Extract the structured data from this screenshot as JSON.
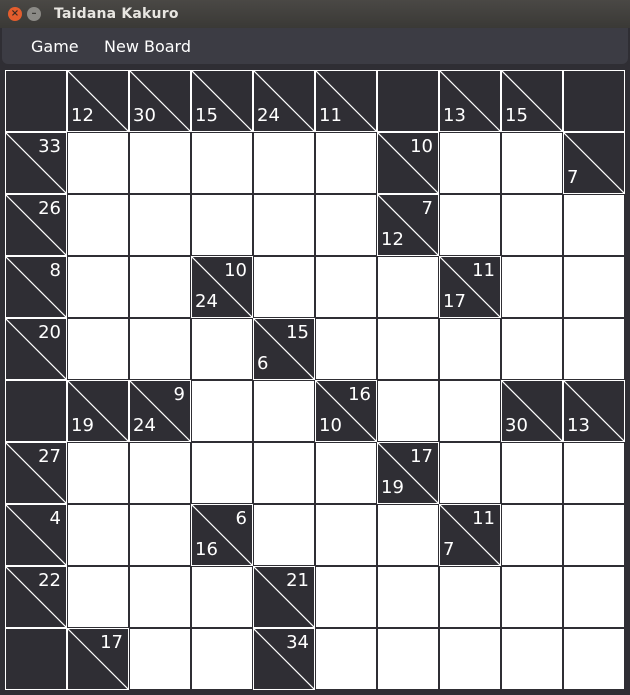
{
  "window": {
    "title": "Taidana Kakuro",
    "close_glyph": "×",
    "minimize_glyph": "–"
  },
  "menu": {
    "game": "Game",
    "new_board": "New Board"
  },
  "board": {
    "rows": [
      [
        {
          "t": "b"
        },
        {
          "t": "c",
          "d": "12"
        },
        {
          "t": "c",
          "d": "30"
        },
        {
          "t": "c",
          "d": "15"
        },
        {
          "t": "c",
          "d": "24"
        },
        {
          "t": "c",
          "d": "11"
        },
        {
          "t": "b"
        },
        {
          "t": "c",
          "d": "13"
        },
        {
          "t": "c",
          "d": "15"
        },
        {
          "t": "b"
        }
      ],
      [
        {
          "t": "c",
          "r": "33"
        },
        {
          "t": "w"
        },
        {
          "t": "w"
        },
        {
          "t": "w"
        },
        {
          "t": "w"
        },
        {
          "t": "w"
        },
        {
          "t": "c",
          "r": "10"
        },
        {
          "t": "w"
        },
        {
          "t": "w"
        },
        {
          "t": "c",
          "d": "7"
        }
      ],
      [
        {
          "t": "c",
          "r": "26"
        },
        {
          "t": "w"
        },
        {
          "t": "w"
        },
        {
          "t": "w"
        },
        {
          "t": "w"
        },
        {
          "t": "w"
        },
        {
          "t": "c",
          "r": "7",
          "d": "12"
        },
        {
          "t": "w"
        },
        {
          "t": "w"
        },
        {
          "t": "w"
        }
      ],
      [
        {
          "t": "c",
          "r": "8"
        },
        {
          "t": "w"
        },
        {
          "t": "w"
        },
        {
          "t": "c",
          "r": "10",
          "d": "24"
        },
        {
          "t": "w"
        },
        {
          "t": "w"
        },
        {
          "t": "w"
        },
        {
          "t": "c",
          "r": "11",
          "d": "17"
        },
        {
          "t": "w"
        },
        {
          "t": "w"
        }
      ],
      [
        {
          "t": "c",
          "r": "20"
        },
        {
          "t": "w"
        },
        {
          "t": "w"
        },
        {
          "t": "w"
        },
        {
          "t": "c",
          "r": "15",
          "d": "6"
        },
        {
          "t": "w"
        },
        {
          "t": "w"
        },
        {
          "t": "w"
        },
        {
          "t": "w"
        },
        {
          "t": "w"
        }
      ],
      [
        {
          "t": "b"
        },
        {
          "t": "c",
          "d": "19"
        },
        {
          "t": "c",
          "r": "9",
          "d": "24"
        },
        {
          "t": "w"
        },
        {
          "t": "w"
        },
        {
          "t": "c",
          "r": "16",
          "d": "10"
        },
        {
          "t": "w"
        },
        {
          "t": "w"
        },
        {
          "t": "c",
          "d": "30"
        },
        {
          "t": "c",
          "d": "13"
        }
      ],
      [
        {
          "t": "c",
          "r": "27"
        },
        {
          "t": "w"
        },
        {
          "t": "w"
        },
        {
          "t": "w"
        },
        {
          "t": "w"
        },
        {
          "t": "w"
        },
        {
          "t": "c",
          "r": "17",
          "d": "19"
        },
        {
          "t": "w"
        },
        {
          "t": "w"
        },
        {
          "t": "w"
        }
      ],
      [
        {
          "t": "c",
          "r": "4"
        },
        {
          "t": "w"
        },
        {
          "t": "w"
        },
        {
          "t": "c",
          "r": "6",
          "d": "16"
        },
        {
          "t": "w"
        },
        {
          "t": "w"
        },
        {
          "t": "w"
        },
        {
          "t": "c",
          "r": "11",
          "d": "7"
        },
        {
          "t": "w"
        },
        {
          "t": "w"
        }
      ],
      [
        {
          "t": "c",
          "r": "22"
        },
        {
          "t": "w"
        },
        {
          "t": "w"
        },
        {
          "t": "w"
        },
        {
          "t": "c",
          "r": "21"
        },
        {
          "t": "w"
        },
        {
          "t": "w"
        },
        {
          "t": "w"
        },
        {
          "t": "w"
        },
        {
          "t": "w"
        }
      ],
      [
        {
          "t": "b"
        },
        {
          "t": "c",
          "r": "17"
        },
        {
          "t": "w"
        },
        {
          "t": "w"
        },
        {
          "t": "c",
          "r": "34"
        },
        {
          "t": "w"
        },
        {
          "t": "w"
        },
        {
          "t": "w"
        },
        {
          "t": "w"
        },
        {
          "t": "w"
        }
      ]
    ]
  }
}
